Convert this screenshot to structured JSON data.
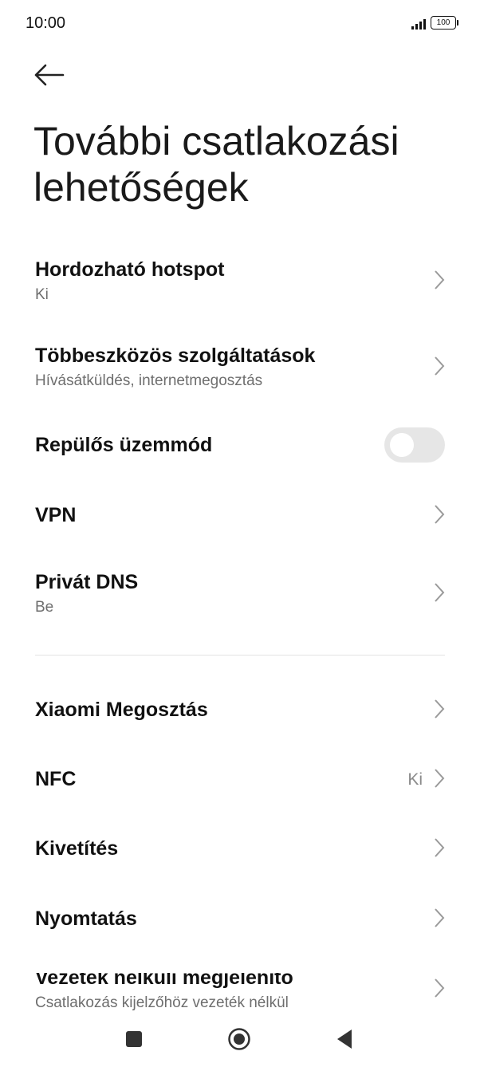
{
  "status_bar": {
    "time": "10:00",
    "battery": "100"
  },
  "header": {
    "back_icon": "arrow-left-icon",
    "title": "További csatlakozási lehetőségek"
  },
  "items": [
    {
      "title": "Hordozható hotspot",
      "subtitle": "Ki",
      "control": "chevron"
    },
    {
      "title": "Többeszközös szolgáltatások",
      "subtitle": "Hívásátküldés, internetmegosztás",
      "control": "chevron"
    },
    {
      "title": "Repülős üzemmód",
      "control": "toggle",
      "toggle_on": false
    },
    {
      "title": "VPN",
      "control": "chevron"
    },
    {
      "title": "Privát DNS",
      "subtitle": "Be",
      "control": "chevron"
    },
    {
      "title": "Xiaomi Megosztás",
      "control": "chevron"
    },
    {
      "title": "NFC",
      "value": "Ki",
      "control": "chevron"
    },
    {
      "title": "Kivetítés",
      "control": "chevron"
    },
    {
      "title": "Nyomtatás",
      "control": "chevron"
    },
    {
      "title": "Vezeték nélküli megjelenítő",
      "subtitle": "Csatlakozás kijelzőhöz vezeték nélkül",
      "control": "chevron"
    }
  ],
  "nav_bar": {
    "recents_icon": "square-icon",
    "home_icon": "circle-icon",
    "back_icon": "triangle-back-icon"
  },
  "colors": {
    "text_primary": "#111111",
    "text_secondary": "#6e6e6e",
    "chevron": "#9a9a9a",
    "toggle_off": "#e6e6e6"
  }
}
